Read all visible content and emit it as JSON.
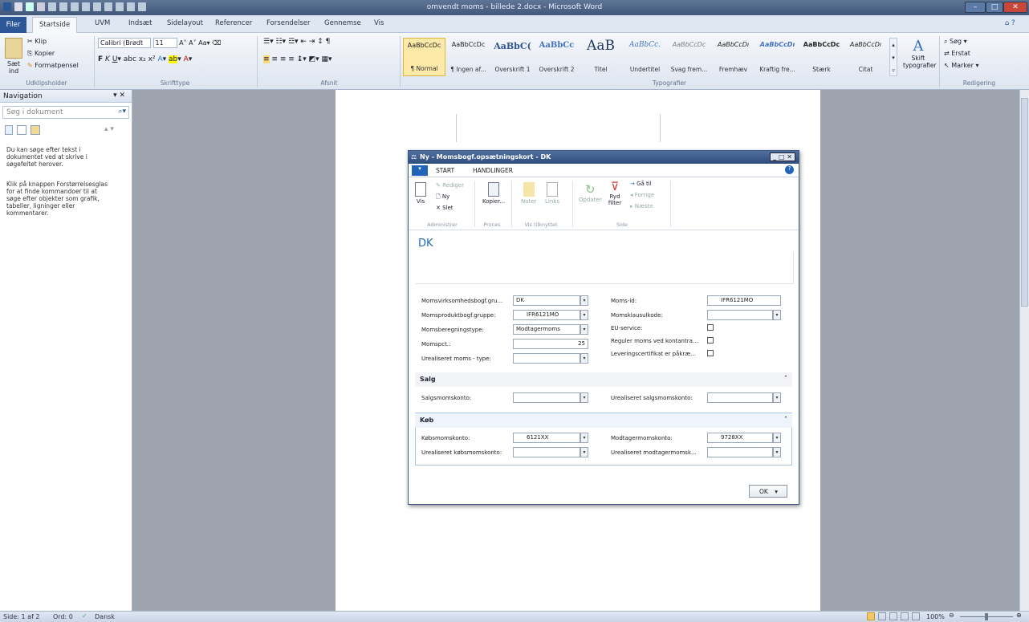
{
  "window": {
    "title": "omvendt moms - billede 2.docx - Microsoft Word",
    "minimize": "–",
    "maximize": "□",
    "close": "✕"
  },
  "ribbon_tabs": [
    "Filer",
    "Startside",
    "UVM",
    "Indsæt",
    "Sidelayout",
    "Referencer",
    "Forsendelser",
    "Gennemse",
    "Vis"
  ],
  "clipboard": {
    "paste": "Sæt ind",
    "cut": "Klip",
    "copy": "Kopier",
    "format_painter": "Formatpensel",
    "label": "Udklipsholder"
  },
  "font": {
    "family": "Calibri (Brødt",
    "size": "11",
    "label": "Skrifttype"
  },
  "paragraph": {
    "label": "Afsnit"
  },
  "styles": {
    "label": "Typografier",
    "items": [
      {
        "sample": "AaBbCcDc",
        "name": "¶ Normal"
      },
      {
        "sample": "AaBbCcDc",
        "name": "¶ Ingen af..."
      },
      {
        "sample": "AaBbC(",
        "name": "Overskrift 1"
      },
      {
        "sample": "AaBbCc",
        "name": "Overskrift 2"
      },
      {
        "sample": "AaB",
        "name": "Titel"
      },
      {
        "sample": "AaBbCc.",
        "name": "Undertitel"
      },
      {
        "sample": "AaBbCcDc",
        "name": "Svag frem..."
      },
      {
        "sample": "AaBbCcDı",
        "name": "Fremhæv"
      },
      {
        "sample": "AaBbCcDı",
        "name": "Kraftig fre..."
      },
      {
        "sample": "AaBbCcDc",
        "name": "Stærk"
      },
      {
        "sample": "AaBbCcDı",
        "name": "Citat"
      }
    ],
    "change_styles": "Skift typografier"
  },
  "editing": {
    "find": "Søg",
    "replace": "Erstat",
    "select": "Marker",
    "label": "Redigering"
  },
  "navigation": {
    "title": "Navigation",
    "search_placeholder": "Søg i dokument",
    "help1": "Du kan søge efter tekst i dokumentet ved at skrive i søgefeltet herover.",
    "help2": "Klik på knappen Forstørrelsesglas for at finde kommandoer til at søge efter objekter som grafik, tabeller, ligninger eller kommentarer."
  },
  "status": {
    "page": "Side: 1 af 2",
    "words": "Ord: 0",
    "language": "Dansk",
    "zoom": "100%"
  },
  "dialog": {
    "title": "Ny - Momsbogf.opsætningskort - DK",
    "tabs": [
      "START",
      "HANDLINGER"
    ],
    "ribbon": {
      "vis": "Vis",
      "rediger": "Rediger",
      "ny": "Ny",
      "slet": "Slet",
      "kopier": "Kopier...",
      "noter": "Noter",
      "links": "Links",
      "opdater": "Opdater",
      "ryd_filter": "Ryd filter",
      "gaa_til": "Gå til",
      "forrige": "Forrige",
      "naeste": "Næste",
      "groups": {
        "administrer": "Administrer",
        "proces": "Proces",
        "vis_tilknyttet": "Vis tilknyttet",
        "side": "Side"
      }
    },
    "header": "DK",
    "fields": {
      "momsvirksomhed_label": "Momsvirksomhedsbogf.gru...",
      "momsvirksomhed_value": "DK",
      "momsprodukt_label": "Momsproduktbogf.gruppe:",
      "momsprodukt_value": "IFR6121MO",
      "beregning_label": "Momsberegningstype:",
      "beregning_value": "Modtagermoms",
      "momspct_label": "Momspct.:",
      "momspct_value": "25",
      "urealiseret_type_label": "Urealiseret moms - type:",
      "urealiseret_type_value": "",
      "moms_id_label": "Moms-id:",
      "moms_id_value": "IFR6121MO",
      "klausul_label": "Momsklausulkode:",
      "klausul_value": "",
      "eu_service_label": "EU-service:",
      "reguler_label": "Reguler moms ved kontantra...",
      "levering_label": "Leveringscertifikat er påkræ..."
    },
    "salg": {
      "title": "Salg",
      "konto_label": "Salgsmomskonto:",
      "konto_value": "",
      "urealiseret_label": "Urealiseret salgsmomskonto:",
      "urealiseret_value": ""
    },
    "koeb": {
      "title": "Køb",
      "konto_label": "Købsmomskonto:",
      "konto_value": "6121XX",
      "urealiseret_label": "Urealiseret købsmomskonto:",
      "urealiseret_value": "",
      "modtager_label": "Modtagermomskonto:",
      "modtager_value": "9728XX",
      "urealiseret_modtager_label": "Urealiseret modtagermomsk...",
      "urealiseret_modtager_value": ""
    },
    "ok": "OK"
  }
}
